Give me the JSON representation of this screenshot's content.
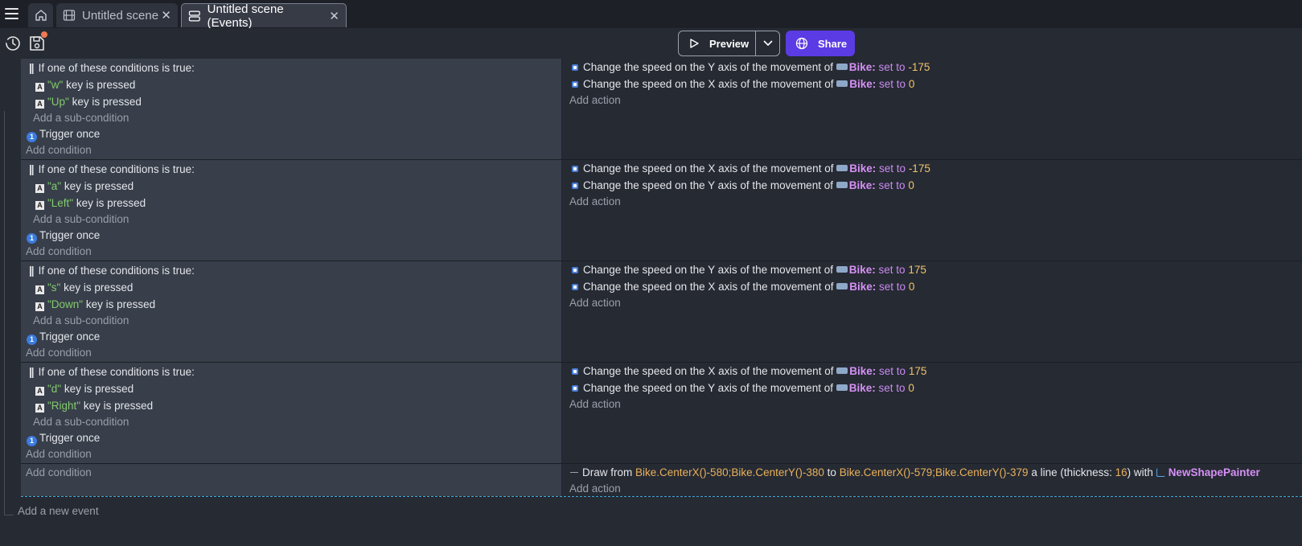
{
  "tabs": [
    {
      "label": "Untitled scene",
      "icon": "film-icon"
    },
    {
      "label": "Untitled scene (Events)",
      "icon": "events-list-icon"
    }
  ],
  "toolbar": {
    "preview_label": "Preview",
    "share_label": "Share"
  },
  "events": [
    {
      "or_label": "If one of these conditions is true:",
      "sub_conditions": [
        {
          "key": "\"w\"",
          "suffix": "key is pressed"
        },
        {
          "key": "\"Up\"",
          "suffix": "key is pressed"
        }
      ],
      "add_sub_condition": "Add a sub-condition",
      "trigger_once": "Trigger once",
      "add_condition": "Add condition",
      "actions": [
        {
          "text": "Change the speed on the Y axis of the movement of",
          "object": "Bike",
          "op": "set to",
          "value": "-175"
        },
        {
          "text": "Change the speed on the X axis of the movement of",
          "object": "Bike",
          "op": "set to",
          "value": "0"
        }
      ],
      "add_action": "Add action"
    },
    {
      "or_label": "If one of these conditions is true:",
      "sub_conditions": [
        {
          "key": "\"a\"",
          "suffix": "key is pressed"
        },
        {
          "key": "\"Left\"",
          "suffix": "key is pressed"
        }
      ],
      "add_sub_condition": "Add a sub-condition",
      "trigger_once": "Trigger once",
      "add_condition": "Add condition",
      "actions": [
        {
          "text": "Change the speed on the X axis of the movement of",
          "object": "Bike",
          "op": "set to",
          "value": "-175"
        },
        {
          "text": "Change the speed on the Y axis of the movement of",
          "object": "Bike",
          "op": "set to",
          "value": "0"
        }
      ],
      "add_action": "Add action"
    },
    {
      "or_label": "If one of these conditions is true:",
      "sub_conditions": [
        {
          "key": "\"s\"",
          "suffix": "key is pressed"
        },
        {
          "key": "\"Down\"",
          "suffix": "key is pressed"
        }
      ],
      "add_sub_condition": "Add a sub-condition",
      "trigger_once": "Trigger once",
      "add_condition": "Add condition",
      "actions": [
        {
          "text": "Change the speed on the Y axis of the movement of",
          "object": "Bike",
          "op": "set to",
          "value": "175"
        },
        {
          "text": "Change the speed on the X axis of the movement of",
          "object": "Bike",
          "op": "set to",
          "value": "0"
        }
      ],
      "add_action": "Add action"
    },
    {
      "or_label": "If one of these conditions is true:",
      "sub_conditions": [
        {
          "key": "\"d\"",
          "suffix": "key is pressed"
        },
        {
          "key": "\"Right\"",
          "suffix": "key is pressed"
        }
      ],
      "add_sub_condition": "Add a sub-condition",
      "trigger_once": "Trigger once",
      "add_condition": "Add condition",
      "actions": [
        {
          "text": "Change the speed on the X axis of the movement of",
          "object": "Bike",
          "op": "set to",
          "value": "175"
        },
        {
          "text": "Change the speed on the Y axis of the movement of",
          "object": "Bike",
          "op": "set to",
          "value": "0"
        }
      ],
      "add_action": "Add action"
    }
  ],
  "draw_event": {
    "add_condition": "Add condition",
    "draw_from": "Draw from",
    "from_expr": "Bike.CenterX()-580;Bike.CenterY()-380",
    "to_label": "to",
    "to_expr": "Bike.CenterX()-579;Bike.CenterY()-379",
    "line_label": "a line (thickness:",
    "thickness": "16",
    "with_label": ") with",
    "painter": "NewShapePainter",
    "add_action": "Add action"
  },
  "add_new_event": "Add a new event",
  "colors": {
    "share": "#5b3be3",
    "selection": "#3ea9d9"
  }
}
